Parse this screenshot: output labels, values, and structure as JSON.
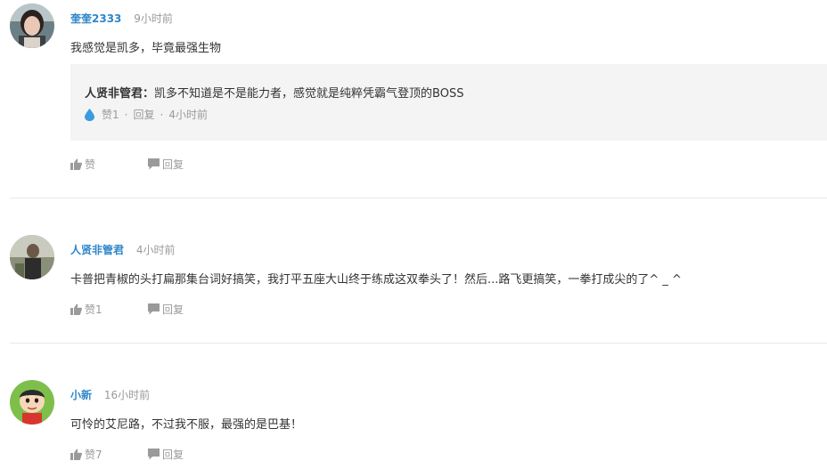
{
  "comments": [
    {
      "username": "奎奎2333",
      "time": "9小时前",
      "avatar_icon": "avatar-girl",
      "content": "我感觉是凯多，毕竟最强生物",
      "reply": {
        "author": "人贤非管君：",
        "text": "凯多不知道是不是能力者，感觉就是纯粹凭霸气登顶的BOSS",
        "like": "赞1",
        "reply_label": "回复",
        "time": "4小时前",
        "sep": "·",
        "icon": "water-drop-icon"
      },
      "like_label": "赞",
      "reply_label": "回复"
    },
    {
      "username": "人贤非管君",
      "time": "4小时前",
      "avatar_icon": "avatar-man",
      "content": "卡普把青椒的头打扁那集台词好搞笑，我打平五座大山终于练成这双拳头了！然后...路飞更搞笑，一拳打成尖的了^ _ ^",
      "like_label": "赞1",
      "reply_label": "回复"
    },
    {
      "username": "小新",
      "time": "16小时前",
      "avatar_icon": "avatar-cartoon",
      "content": "可怜的艾尼路，不过我不服，最强的是巴基！",
      "like_label": "赞7",
      "reply_label": "回复"
    }
  ],
  "colors": {
    "username": "#2f86c9",
    "meta": "#9a9a9a",
    "reply_bg": "#f4f4f4",
    "divider": "#e8e8e8",
    "drop": "#3a9be0"
  }
}
